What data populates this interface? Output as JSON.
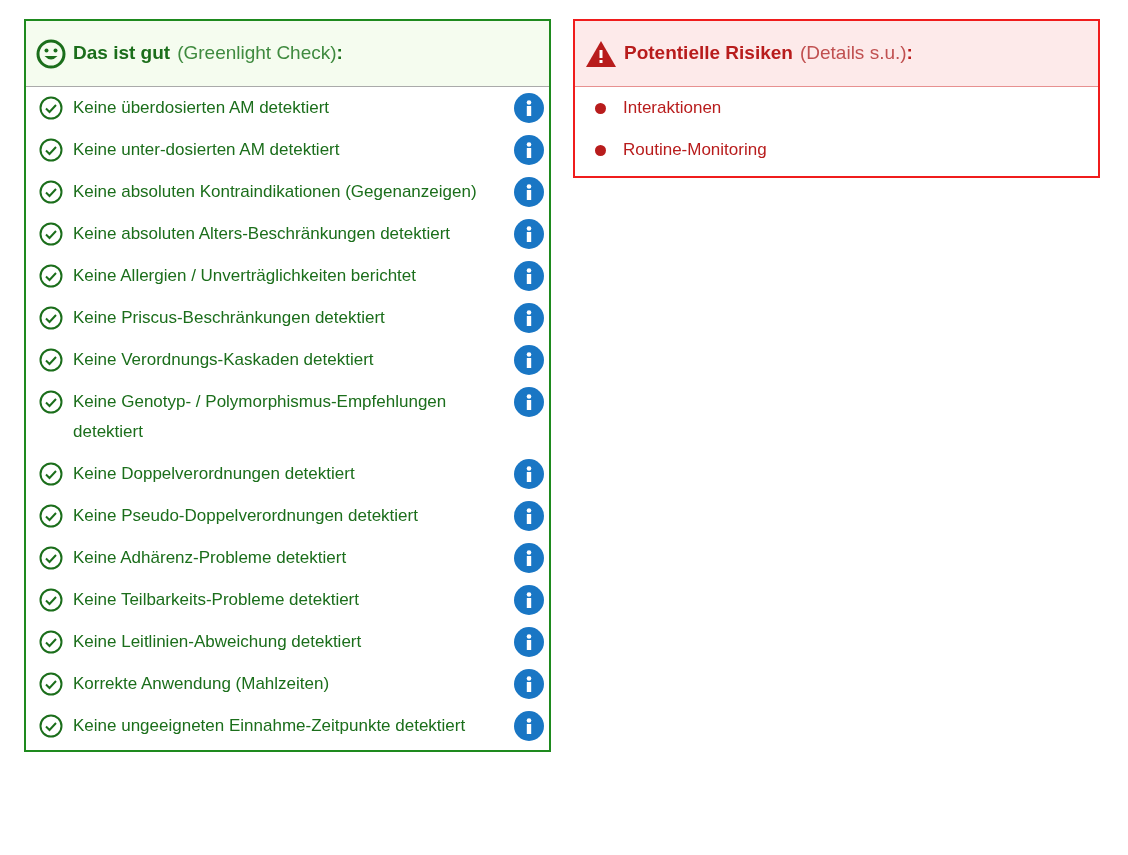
{
  "good_panel": {
    "title": "Das ist gut",
    "note": "(Greenlight Check)",
    "colon": ":",
    "items": [
      {
        "text": "Keine überdosierten AM detektiert"
      },
      {
        "text": "Keine unter-dosierten AM detektiert"
      },
      {
        "text": "Keine absoluten Kontraindikationen (Gegenanzeigen)"
      },
      {
        "text": "Keine absoluten Alters-Beschränkungen detektiert"
      },
      {
        "text": "Keine Allergien / Unverträglichkeiten berichtet"
      },
      {
        "text": "Keine Priscus-Beschränkungen detektiert"
      },
      {
        "text": "Keine Verordnungs-Kaskaden detektiert"
      },
      {
        "text": "Keine Genotyp- / Polymorphismus-Empfehlungen detektiert"
      },
      {
        "text": "Keine Doppelverordnungen detektiert"
      },
      {
        "text": "Keine Pseudo-Doppelverordnungen detektiert"
      },
      {
        "text": "Keine Adhärenz-Probleme detektiert"
      },
      {
        "text": "Keine Teilbarkeits-Probleme detektiert"
      },
      {
        "text": "Keine Leitlinien-Abweichung detektiert"
      },
      {
        "text": "Korrekte Anwendung (Mahlzeiten)"
      },
      {
        "text": "Keine ungeeigneten Einnahme-Zeitpunkte detektiert"
      }
    ]
  },
  "risk_panel": {
    "title": "Potentielle Risiken",
    "note": "(Details s.u.)",
    "colon": ":",
    "items": [
      {
        "text": "Interaktionen"
      },
      {
        "text": "Routine-Monitoring"
      }
    ]
  }
}
